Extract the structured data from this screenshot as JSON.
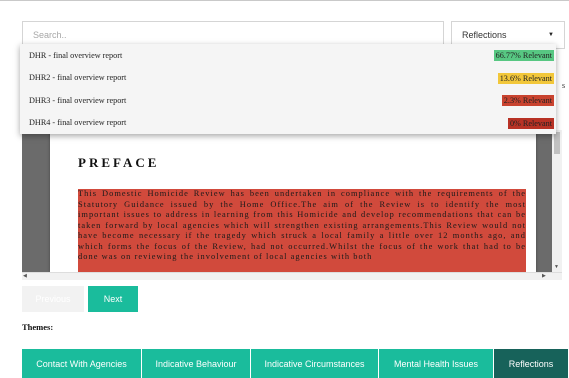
{
  "search": {
    "placeholder": "Search.."
  },
  "filter": {
    "selected": "Reflections",
    "caret": "▼"
  },
  "dropdown": {
    "items": [
      {
        "title": "DHR - final overview report",
        "relevance": "66.77% Relevant",
        "color": "#57c782"
      },
      {
        "title": "DHR2 - final overview report",
        "relevance": "13.6% Relevant",
        "color": "#f2c73a"
      },
      {
        "title": "DHR3 - final overview report",
        "relevance": "2.3% Relevant",
        "color": "#c9432f"
      },
      {
        "title": "DHR4 - final overview report",
        "relevance": "0% Relevant",
        "color": "#b83225"
      }
    ]
  },
  "overflow_char": "s",
  "document": {
    "heading": "PREFACE",
    "paragraph": "This Domestic Homicide Review has been undertaken in compliance with the requirements of the Statutory Guidance issued by the Home Office.The aim of the Review is to identify the most important issues to address in learning from this Homicide and develop recommendations that can be taken forward by local agencies which will strengthen existing arrangements.This Review would not have become necessary if the tragedy which struck a local family a little over 12 months ago, and which forms the focus of the Review, had not occurred.Whilst the focus of the work that had to be done was on reviewing the involvement of local agencies with both"
  },
  "pagination": {
    "previous": "Previous",
    "next": "Next"
  },
  "themes": {
    "label": "Themes:",
    "tabs": [
      {
        "label": "Contact With Agencies"
      },
      {
        "label": "Indicative Behaviour"
      },
      {
        "label": "Indicative Circumstances"
      },
      {
        "label": "Mental Health Issues"
      },
      {
        "label": "Reflections"
      }
    ]
  },
  "colors": {
    "accent": "#1abc9c",
    "active_tab": "#17625a",
    "highlight": "#d14a3c"
  }
}
